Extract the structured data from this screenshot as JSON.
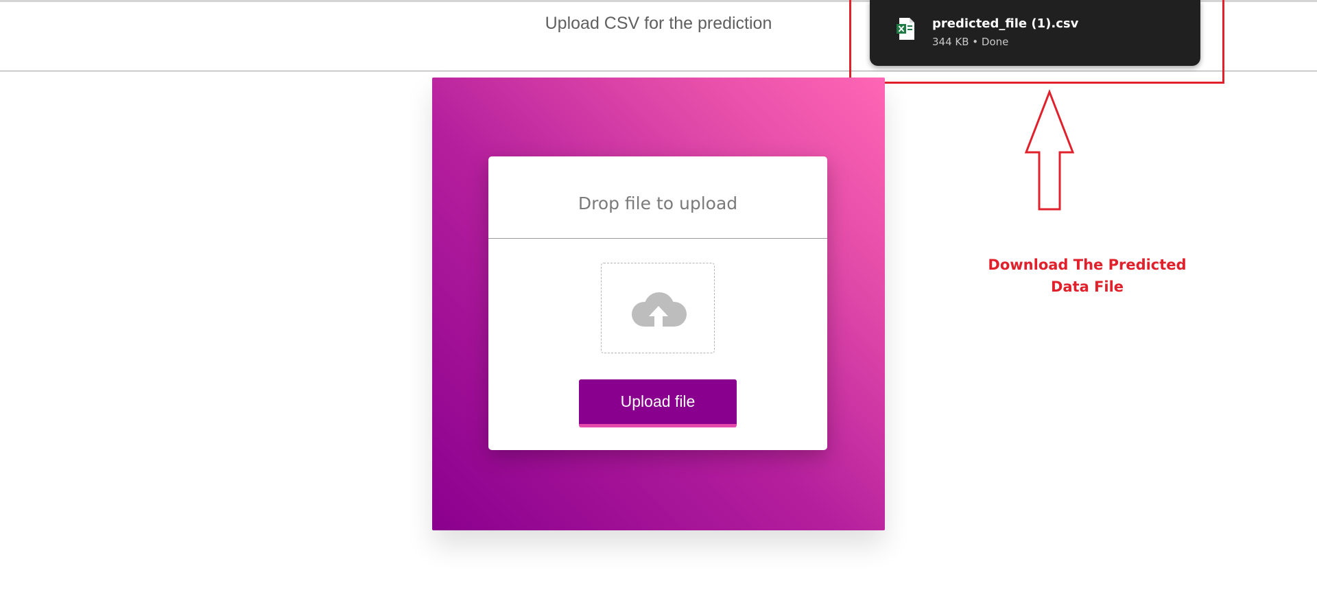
{
  "header": {
    "title": "Upload CSV for the prediction"
  },
  "download": {
    "file_name": "predicted_file (1).csv",
    "file_meta": "344 KB • Done",
    "icon": "excel-file-icon"
  },
  "annotation": {
    "line1": "Download The Predicted",
    "line2": "Data File",
    "color": "#e0202a"
  },
  "upload_card": {
    "title": "Drop file to upload",
    "dropzone_icon": "cloud-upload-icon",
    "button_label": "Upload file"
  },
  "colors": {
    "accent": "#8a008e",
    "gradient_start": "#8a008e",
    "gradient_end": "#ff66b4",
    "button_underline": "#e44aa9",
    "popup_bg": "#202020"
  }
}
